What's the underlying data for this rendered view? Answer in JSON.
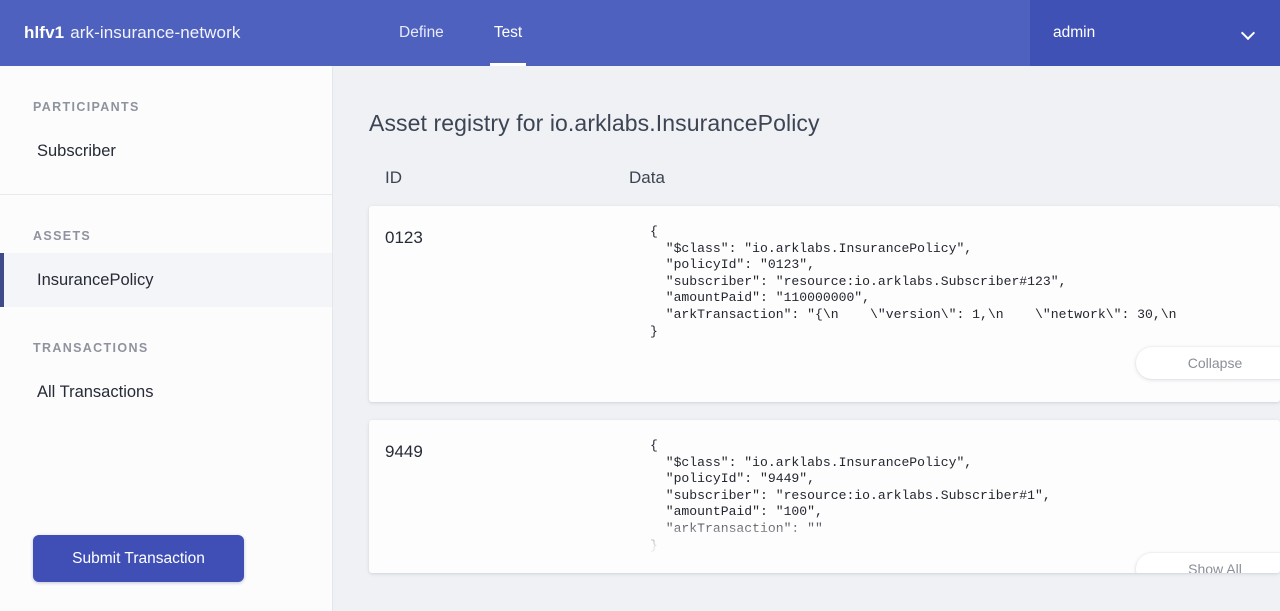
{
  "header": {
    "brand_strong": "hlfv1",
    "brand_rest": "ark-insurance-network",
    "tabs": [
      {
        "label": "Define",
        "active": false
      },
      {
        "label": "Test",
        "active": true
      }
    ],
    "user": "admin",
    "user_caret_icon": "chevron-down-icon"
  },
  "sidebar": {
    "sections": [
      {
        "title": "PARTICIPANTS",
        "items": [
          {
            "label": "Subscriber",
            "selected": false
          }
        ]
      },
      {
        "title": "ASSETS",
        "items": [
          {
            "label": "InsurancePolicy",
            "selected": true
          }
        ]
      },
      {
        "title": "TRANSACTIONS",
        "items": [
          {
            "label": "All Transactions",
            "selected": false
          }
        ]
      }
    ],
    "submit_button": "Submit Transaction"
  },
  "main": {
    "title": "Asset registry for io.arklabs.InsurancePolicy",
    "columns": {
      "id": "ID",
      "data": "Data"
    },
    "rows": [
      {
        "id": "0123",
        "json": "{\n  \"$class\": \"io.arklabs.InsurancePolicy\",\n  \"policyId\": \"0123\",\n  \"subscriber\": \"resource:io.arklabs.Subscriber#123\",\n  \"amountPaid\": \"110000000\",\n  \"arkTransaction\": \"{\\n    \\\"version\\\": 1,\\n    \\\"network\\\": 30,\\n\n}",
        "action_label": "Collapse",
        "expanded": true
      },
      {
        "id": "9449",
        "json": "{\n  \"$class\": \"io.arklabs.InsurancePolicy\",\n  \"policyId\": \"9449\",\n  \"subscriber\": \"resource:io.arklabs.Subscriber#1\",\n  \"amountPaid\": \"100\",\n  \"arkTransaction\": \"\"\n}",
        "action_label": "Show All",
        "expanded": false
      }
    ]
  },
  "colors": {
    "header_blue": "#4f61be",
    "user_menu_blue": "#3f51b5",
    "accent_button": "#3f4fb5",
    "selected_bar": "#3f4a8c",
    "page_bg": "#eff1f5",
    "card_bg": "#fdfdfe"
  }
}
